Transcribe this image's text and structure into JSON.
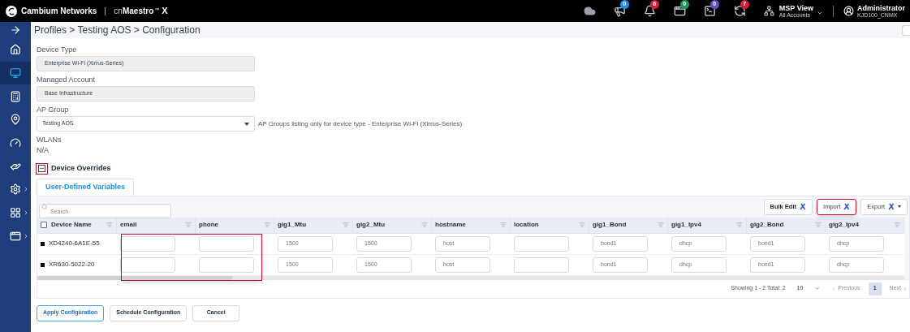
{
  "top_bar": {
    "company": "Cambium Networks",
    "product_prefix": "cn",
    "product": "Maestro",
    "trademark": "™",
    "product_suffix": "X",
    "notifications": [
      {
        "badge": "0",
        "color": "#1a8fe3"
      },
      {
        "badge": "6",
        "color": "#d0213a"
      },
      {
        "badge": "0",
        "color": "#219a5b"
      },
      {
        "badge": "0",
        "color": "#6b4fbb"
      },
      {
        "badge": "7",
        "color": "#d0213a"
      }
    ],
    "view": {
      "title": "MSP View",
      "subtitle": "All Accounts"
    },
    "user": {
      "name": "Administrator",
      "account": "KJD100_CNMX"
    }
  },
  "sidebar": {
    "items": [
      {
        "selected": false,
        "expandable": false
      },
      {
        "selected": true,
        "expandable": false
      },
      {
        "selected": false,
        "expandable": false
      },
      {
        "selected": false,
        "expandable": false
      },
      {
        "selected": false,
        "expandable": false
      },
      {
        "selected": false,
        "expandable": false
      },
      {
        "selected": false,
        "expandable": true
      },
      {
        "selected": false,
        "expandable": true
      },
      {
        "selected": false,
        "expandable": true
      }
    ]
  },
  "breadcrumb": "Profiles > Testing AOS > Configuration",
  "form": [
    {
      "kind": "readonly",
      "label": "Device Type",
      "value": "Enterprise Wi-Fi (Xirrus-Series)"
    },
    {
      "kind": "readonly",
      "label": "Managed Account",
      "value": "Base Infrastructure"
    },
    {
      "kind": "select",
      "label": "AP Group",
      "value": "Testing AOS",
      "note": "AP Groups listing only for device type - Enterprise Wi-Fi (Xirrus-Series)"
    },
    {
      "kind": "text",
      "label": "WLANs",
      "value": "N/A"
    }
  ],
  "device_overrides": {
    "title": "Device Overrides",
    "expanded": true,
    "highlighted": true
  },
  "tabs": [
    {
      "label": "User-Defined Variables",
      "selected": true
    }
  ],
  "search": {
    "placeholder": "Search"
  },
  "toolbar": [
    {
      "label": "Bulk Edit",
      "highlighted": false,
      "dropdown": false
    },
    {
      "label": "Import",
      "highlighted": true,
      "dropdown": false
    },
    {
      "label": "Export",
      "highlighted": false,
      "dropdown": true
    }
  ],
  "table": {
    "select_all_checked": false,
    "highlight_frame": true,
    "columns": [
      {
        "label": "Device Name"
      },
      {
        "label": "email"
      },
      {
        "label": "phone"
      },
      {
        "label": "gig1_Mtu"
      },
      {
        "label": "gig2_Mtu"
      },
      {
        "label": "hostname"
      },
      {
        "label": "location"
      },
      {
        "label": "gig1_Bond"
      },
      {
        "label": "gig1_Ipv4"
      },
      {
        "label": "gig2_Bond"
      },
      {
        "label": "gig2_Ipv4"
      }
    ],
    "rows": [
      {
        "cells": [
          {
            "value": "XD4240-6A1E-55"
          },
          {},
          {},
          {
            "value": "1500"
          },
          {
            "value": "1500"
          },
          {
            "value": "host"
          },
          {},
          {
            "value": "bond1"
          },
          {
            "value": "dhcp"
          },
          {
            "value": "bond1"
          },
          {
            "value": "dhcp"
          }
        ]
      },
      {
        "cells": [
          {
            "value": "XR630-5022-20"
          },
          {},
          {},
          {
            "value": "1500"
          },
          {
            "value": "1500"
          },
          {
            "value": "host"
          },
          {},
          {
            "value": "bond1"
          },
          {
            "value": "dhcp"
          },
          {
            "value": "bond1"
          },
          {
            "value": "dhcp"
          }
        ]
      }
    ]
  },
  "pagination": {
    "summary": "Showing 1 - 2 Total: 2",
    "page_size": "10",
    "previous": {
      "label": "Previous",
      "disabled": true
    },
    "pages": [
      {
        "label": "1",
        "selected": true
      }
    ],
    "next": {
      "label": "Next",
      "disabled": true
    }
  },
  "actions": [
    {
      "label": "Apply Configuration",
      "primary": true
    },
    {
      "label": "Schedule Configuration",
      "primary": false
    },
    {
      "label": "Cancel",
      "primary": false
    }
  ]
}
